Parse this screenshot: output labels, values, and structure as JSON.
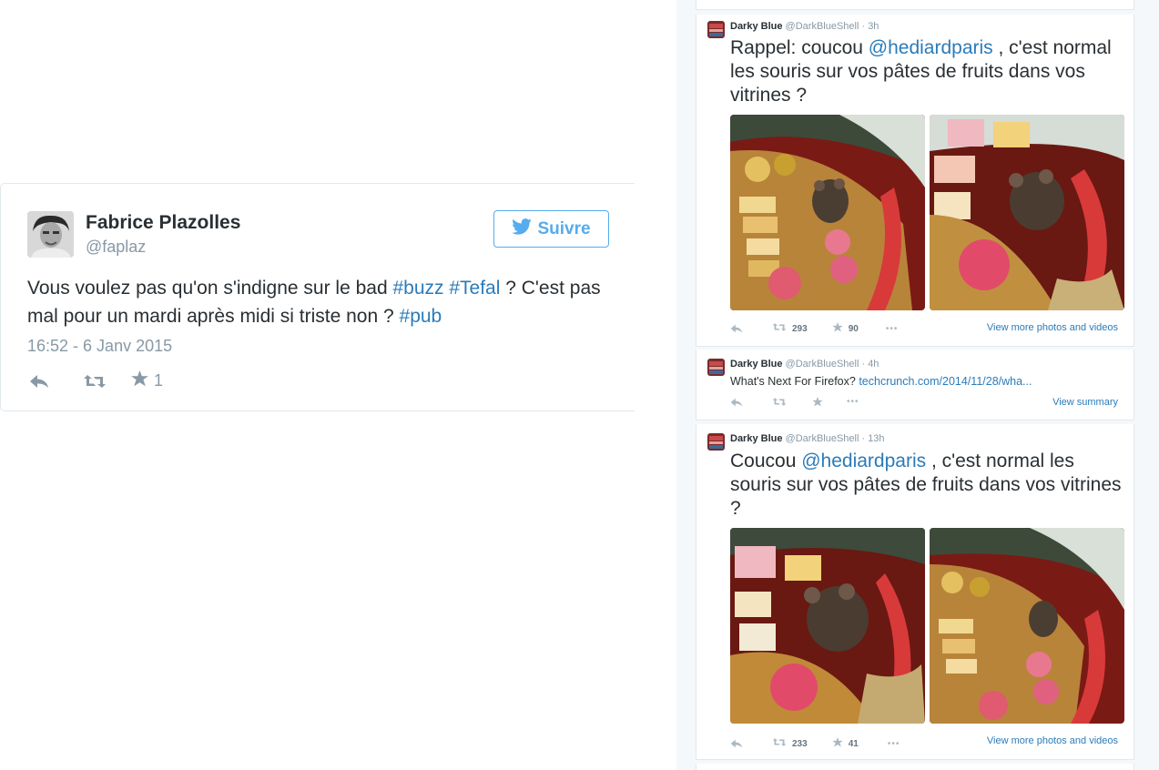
{
  "embed": {
    "name": "Fabrice Plazolles",
    "handle": "@faplaz",
    "follow_label": "Suivre",
    "text_before": "Vous voulez pas qu'on s'indigne sur le bad ",
    "hashtag1": "#buzz",
    "hashtag2": "#Tefal",
    "text_middle": " ? C'est pas mal pour un mardi après midi si triste non ? ",
    "hashtag3": "#pub",
    "time": "16:52 - 6 Janv 2015",
    "favorites": "1"
  },
  "timeline": {
    "tweet1": {
      "name": "Darky Blue",
      "handle_time": "@DarkBlueShell · 3h",
      "text_before": "Rappel: coucou ",
      "mention": "@hediardparis",
      "text_after": " , c'est normal les souris sur vos pâtes de fruits dans vos vitrines ?",
      "retweets": "293",
      "favorites": "90",
      "more": "•••",
      "link": "View more photos and videos"
    },
    "tweet2": {
      "name": "Darky Blue",
      "handle_time": "@DarkBlueShell · 4h",
      "text": "What's Next For Firefox? ",
      "url": "techcrunch.com/2014/11/28/wha...",
      "more": "•••",
      "link": "View summary"
    },
    "tweet3": {
      "name": "Darky Blue",
      "handle_time": "@DarkBlueShell · 13h",
      "text_before": "Coucou ",
      "mention": "@hediardparis",
      "text_after": " , c'est normal les souris sur vos pâtes de fruits dans vos vitrines ?",
      "retweets": "233",
      "favorites": "41",
      "more": "•••",
      "link": "View more photos and videos"
    }
  },
  "colors": {
    "link": "#2b7bb9",
    "twitter_blue": "#55acee",
    "muted": "#8899a6",
    "text": "#292f33"
  },
  "icons": [
    "reply-icon",
    "retweet-icon",
    "star-icon",
    "twitter-bird-icon",
    "more-icon"
  ]
}
